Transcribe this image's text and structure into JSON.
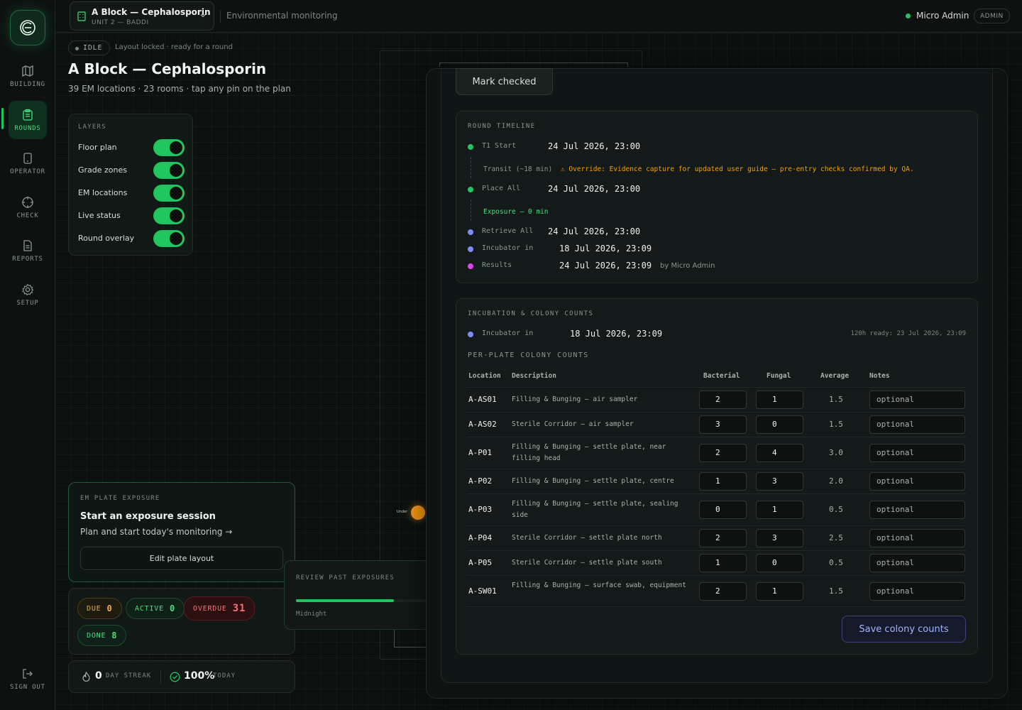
{
  "sidebar": {
    "items": [
      {
        "label": "BUILDING",
        "icon": "map-icon"
      },
      {
        "label": "ROUNDS",
        "icon": "clipboard-icon",
        "active": true
      },
      {
        "label": "OPERATOR",
        "icon": "tablet-icon"
      },
      {
        "label": "CHECK",
        "icon": "crosshair-icon"
      },
      {
        "label": "REPORTS",
        "icon": "document-icon"
      },
      {
        "label": "SETUP",
        "icon": "gear-icon"
      }
    ],
    "signout": "SIGN OUT"
  },
  "topbar": {
    "building_title": "A Block — Cephalosporin",
    "building_sub": "UNIT 2 — BADDI",
    "section": "Environmental monitoring",
    "user": "Micro Admin",
    "role": "ADMIN"
  },
  "header": {
    "status": "IDLE",
    "status_note": "Layout locked · ready for a round",
    "title": "A Block — Cephalosporin",
    "subtitle": "39 EM locations · 23 rooms · tap any pin on the plan"
  },
  "layers": {
    "heading": "LAYERS",
    "items": [
      {
        "label": "Floor plan",
        "on": true
      },
      {
        "label": "Grade zones",
        "on": true
      },
      {
        "label": "EM locations",
        "on": true
      },
      {
        "label": "Live status",
        "on": true
      },
      {
        "label": "Round overlay",
        "on": true
      }
    ]
  },
  "plan": {
    "pin_label": "Under",
    "pin_color": "#f59e0b"
  },
  "exposure": {
    "heading": "EM PLATE EXPOSURE",
    "title": "Start an exposure session",
    "subtitle": "Plan and start today's monitoring →",
    "button": "Edit plate layout"
  },
  "counters": {
    "due": {
      "label": "DUE",
      "value": "0"
    },
    "active": {
      "label": "ACTIVE",
      "value": "0"
    },
    "overdue": {
      "label": "OVERDUE",
      "value": "31"
    },
    "done": {
      "label": "DONE",
      "value": "8"
    }
  },
  "streak": {
    "days": "0",
    "days_label": "DAY STREAK",
    "today": "100%",
    "today_label": "TODAY"
  },
  "review": {
    "heading": "REVIEW PAST EXPOSURES",
    "caption": "Midnight",
    "progress": 0.75
  },
  "drawer": {
    "mark_button": "Mark checked",
    "timeline": {
      "heading": "ROUND TIMELINE",
      "t1_label": "T1 Start",
      "t1_value": "24 Jul 2026, 23:00",
      "transit_label": "Transit (~18 min)",
      "override": "⚠ Override: Evidence capture for updated user guide — pre-entry checks confirmed by QA.",
      "place_label": "Place All",
      "place_value": "24 Jul 2026, 23:00",
      "exposure_note": "Exposure — 0 min",
      "retrieve_label": "Retrieve All",
      "retrieve_value": "24 Jul 2026, 23:00",
      "incubator_label": "Incubator in",
      "incubator_value": "18 Jul 2026, 23:09",
      "results_label": "Results",
      "results_value": "24 Jul 2026, 23:09",
      "results_by": "by Micro Admin"
    },
    "incubation": {
      "heading": "INCUBATION & COLONY COUNTS",
      "incubator_label": "Incubator in",
      "incubator_value": "18 Jul 2026, 23:09",
      "ready_note": "120h ready: 23 Jul 2026, 23:09",
      "per_plate_heading": "PER-PLATE COLONY COUNTS",
      "columns": [
        "Location",
        "Description",
        "Bacterial",
        "Fungal",
        "Average",
        "Notes"
      ],
      "rows": [
        {
          "loc": "A-AS01",
          "desc": "Filling & Bunging — air sampler",
          "bact": "2",
          "fung": "1",
          "avg": "1.5",
          "notes": "optional"
        },
        {
          "loc": "A-AS02",
          "desc": "Sterile Corridor — air sampler",
          "bact": "3",
          "fung": "0",
          "avg": "1.5",
          "notes": "optional"
        },
        {
          "loc": "A-P01",
          "desc": "Filling & Bunging — settle plate, near filling head",
          "bact": "2",
          "fung": "4",
          "avg": "3.0",
          "notes": "optional"
        },
        {
          "loc": "A-P02",
          "desc": "Filling & Bunging — settle plate, centre",
          "bact": "1",
          "fung": "3",
          "avg": "2.0",
          "notes": "optional"
        },
        {
          "loc": "A-P03",
          "desc": "Filling & Bunging — settle plate, sealing side",
          "bact": "0",
          "fung": "1",
          "avg": "0.5",
          "notes": "optional"
        },
        {
          "loc": "A-P04",
          "desc": "Sterile Corridor — settle plate north",
          "bact": "2",
          "fung": "3",
          "avg": "2.5",
          "notes": "optional"
        },
        {
          "loc": "A-P05",
          "desc": "Sterile Corridor — settle plate south",
          "bact": "1",
          "fung": "0",
          "avg": "0.5",
          "notes": "optional"
        },
        {
          "loc": "A-SW01",
          "desc": "Filling & Bunging — surface swab, equipment",
          "bact": "2",
          "fung": "1",
          "avg": "1.5",
          "notes": "optional"
        }
      ],
      "save_button": "Save colony counts"
    }
  },
  "colors": {
    "accent": "#22c55e",
    "warning": "#f59e0b",
    "danger": "#f87171",
    "indigo": "#818cf8",
    "magenta": "#d946ef"
  }
}
